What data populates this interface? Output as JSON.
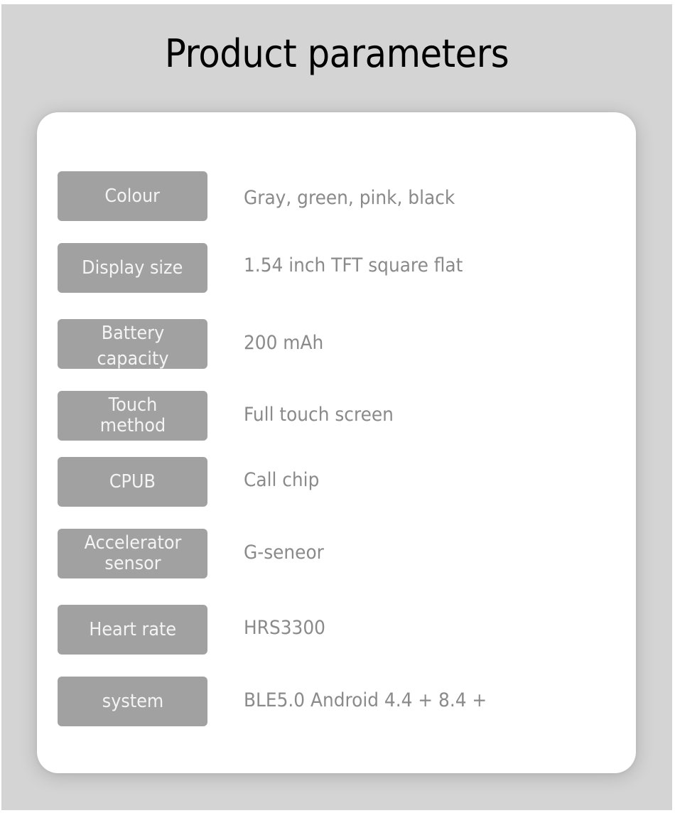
{
  "header": {
    "title": "Product parameters"
  },
  "parameters": [
    {
      "label": "Colour",
      "value": "Gray, green, pink, black"
    },
    {
      "label": "Display size",
      "value": "1.54 inch TFT square flat"
    },
    {
      "label": "Battery capacity",
      "value": "200 mAh"
    },
    {
      "label": "Touch method",
      "value": "Full touch screen"
    },
    {
      "label": "CPUB",
      "value": "Call chip"
    },
    {
      "label": "Accelerator sensor",
      "value": "G-seneor"
    },
    {
      "label": "Heart rate",
      "value": "HRS3300"
    },
    {
      "label": "system",
      "value": "BLE5.0 Android 4.4 + 8.4 +"
    }
  ],
  "colors": {
    "background": "#d4d4d4",
    "card": "#ffffff",
    "label_bg": "#a1a1a1",
    "label_text": "#f4f4f4",
    "value_text": "#8a8a8a",
    "title_text": "#000000"
  }
}
